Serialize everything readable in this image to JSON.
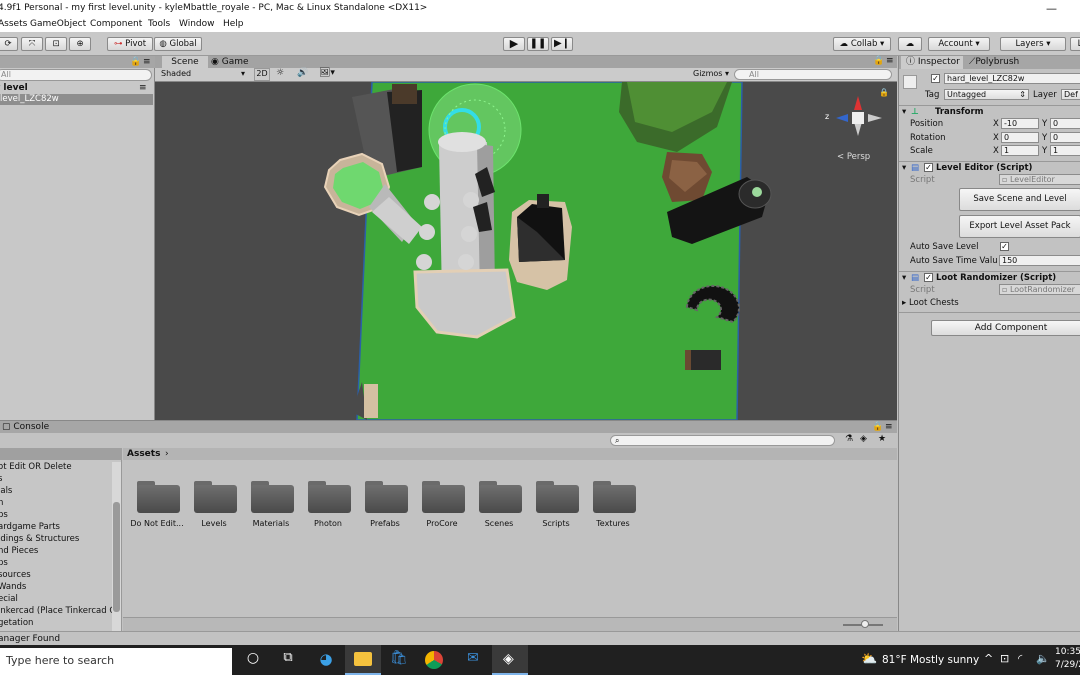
{
  "window": {
    "title": "4.9f1 Personal - my first level.unity - kyleMbattle_royale - PC, Mac & Linux Standalone <DX11>",
    "minimize": "—"
  },
  "menu": [
    "Assets",
    "GameObject",
    "Component",
    "Tools",
    "Window",
    "Help"
  ],
  "toolbar": {
    "pivot": "Pivot",
    "global": "Global",
    "collab": "Collab ▾",
    "account": "Account",
    "layers": "Layers",
    "layout": "L"
  },
  "hierarchy": {
    "search_placeholder": "All",
    "scene_name": "t level",
    "items": [
      "level_LZC82w"
    ]
  },
  "scene": {
    "tabs": [
      "Scene",
      "Game"
    ],
    "shading": "Shaded",
    "mode_2d": "2D",
    "gizmos": "Gizmos",
    "search_placeholder": "All",
    "persp": "< Persp",
    "axis_z": "z"
  },
  "inspector": {
    "tabs": [
      "Inspector",
      "Polybrush"
    ],
    "object_name": "hard_level_LZC82w",
    "tag_label": "Tag",
    "tag_value": "Untagged",
    "layer_label": "Layer",
    "layer_value": "Def",
    "transform": {
      "title": "Transform",
      "rows": [
        {
          "label": "Position",
          "x": "-10",
          "y": "0"
        },
        {
          "label": "Rotation",
          "x": "0",
          "y": "0"
        },
        {
          "label": "Scale",
          "x": "1",
          "y": "1"
        }
      ]
    },
    "level_editor": {
      "title": "Level Editor (Script)",
      "script_label": "Script",
      "script_value": "LevelEditor",
      "save_button": "Save Scene and Level",
      "export_button": "Export Level Asset Pack",
      "auto_save_label": "Auto Save Level",
      "auto_save_time_label": "Auto Save Time Valu",
      "auto_save_time_value": "150"
    },
    "loot_randomizer": {
      "title": "Loot Randomizer (Script)",
      "script_label": "Script",
      "script_value": "LootRandomizer",
      "loot_chests": "Loot Chests"
    },
    "add_component": "Add Component"
  },
  "console": {
    "tab": "Console"
  },
  "project": {
    "breadcrumb": "Assets",
    "tree": [
      "ot Edit OR Delete",
      "s",
      "ials",
      "n",
      "bs",
      "ardgame Parts",
      "ldings & Structures",
      "nd Pieces",
      "ps",
      "sources",
      "Wands",
      "ecial",
      "inkercad (Place Tinkercad O",
      "getation"
    ],
    "folders": [
      "Do Not Edit...",
      "Levels",
      "Materials",
      "Photon",
      "Prefabs",
      "ProCore",
      "Scenes",
      "Scripts",
      "Textures"
    ]
  },
  "status": {
    "message": "anager Found"
  },
  "taskbar": {
    "search_placeholder": "Type here to search",
    "weather": "81°F  Mostly sunny",
    "time": "10:35",
    "date": "7/29/2"
  },
  "colors": {
    "ground_green": "#3ea83a",
    "selection_cyan": "#33dde6",
    "taskbar_bg": "#202020"
  }
}
